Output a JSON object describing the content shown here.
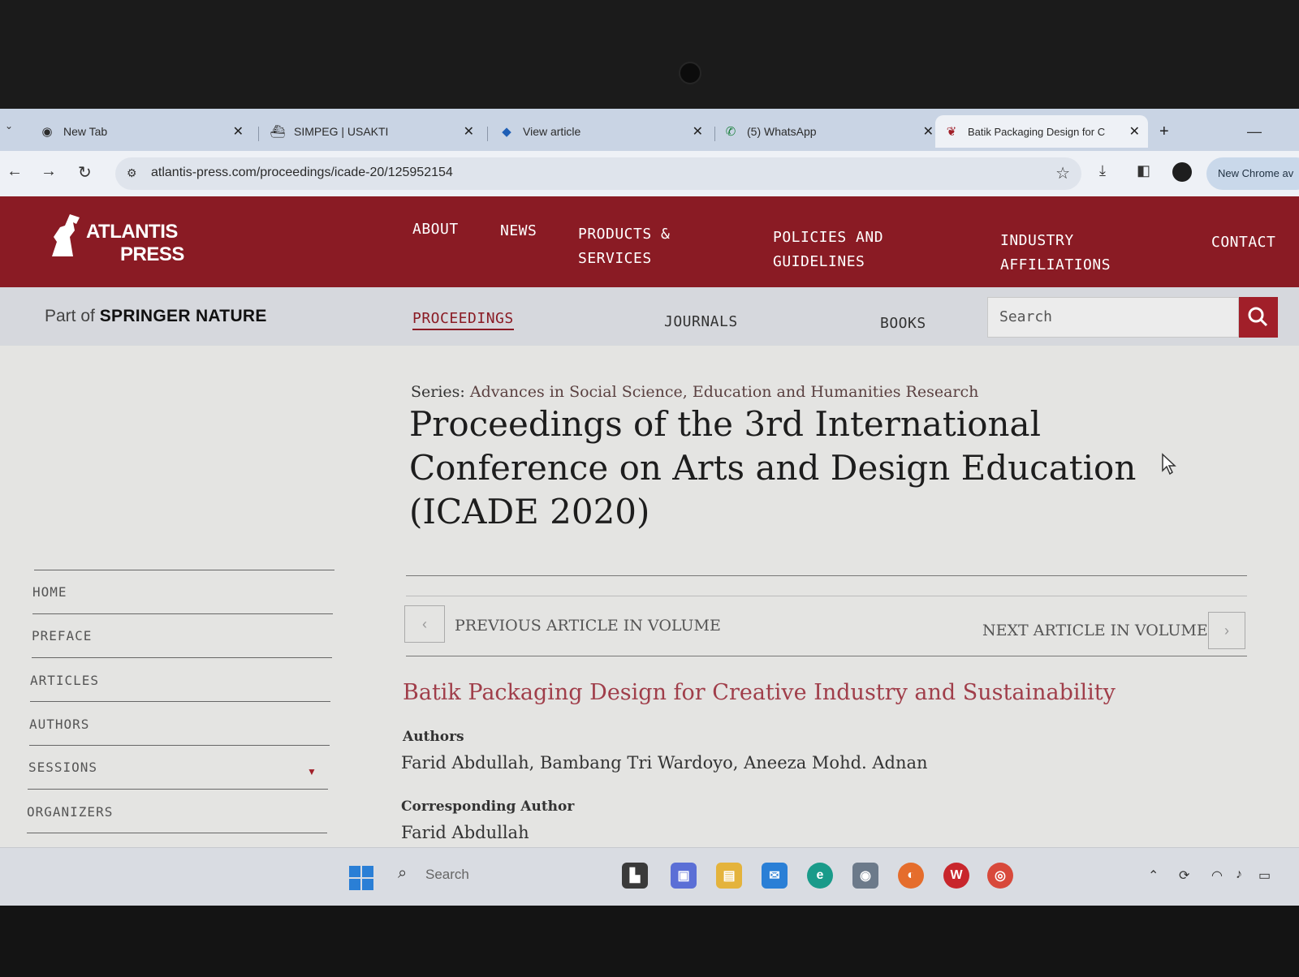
{
  "browser": {
    "tabs": [
      {
        "title": "New Tab",
        "icon": "chrome-icon"
      },
      {
        "title": "SIMPEG | USAKTI",
        "icon": "ship-icon"
      },
      {
        "title": "View article",
        "icon": "diamond-icon"
      },
      {
        "title": "(5) WhatsApp",
        "icon": "whatsapp-icon"
      },
      {
        "title": "Batik Packaging Design for C",
        "icon": "atlantis-icon"
      }
    ],
    "new_tab_label": "+",
    "url": "atlantis-press.com/proceedings/icade-20/125952154",
    "new_chrome_label": "New Chrome av"
  },
  "site": {
    "logo_line1": "ATLANTIS",
    "logo_line2": "PRESS",
    "nav": [
      {
        "line1": "ABOUT",
        "line2": ""
      },
      {
        "line1": "NEWS",
        "line2": ""
      },
      {
        "line1": "PRODUCTS &",
        "line2": "SERVICES"
      },
      {
        "line1": "POLICIES AND",
        "line2": "GUIDELINES"
      },
      {
        "line1": "INDUSTRY",
        "line2": "AFFILIATIONS"
      },
      {
        "line1": "CONTACT",
        "line2": ""
      }
    ],
    "part_of": "Part of",
    "springer": "SPRINGER NATURE",
    "subnav": [
      "PROCEEDINGS",
      "JOURNALS",
      "BOOKS"
    ],
    "search_placeholder": "Search",
    "accent_color": "#8a1b24"
  },
  "page": {
    "series_label": "Series:",
    "series_name": "Advances in Social Science, Education and Humanities Research",
    "title_lines": [
      "Proceedings of the 3rd International",
      "Conference on Arts and Design Education",
      "(ICADE 2020)"
    ],
    "prev_label": "PREVIOUS ARTICLE IN VOLUME",
    "next_label": "NEXT ARTICLE IN VOLUME",
    "prev_glyph": "‹",
    "next_glyph": "›",
    "article_title": "Batik Packaging Design for Creative Industry and Sustainability",
    "authors_label": "Authors",
    "authors": "Farid Abdullah, Bambang Tri Wardoyo, Aneeza Mohd. Adnan",
    "corresponding_label": "Corresponding Author",
    "corresponding": "Farid Abdullah"
  },
  "sidebar": {
    "items": [
      "HOME",
      "PREFACE",
      "ARTICLES",
      "AUTHORS",
      "SESSIONS",
      "ORGANIZERS"
    ]
  },
  "taskbar": {
    "search_label": "Search"
  }
}
